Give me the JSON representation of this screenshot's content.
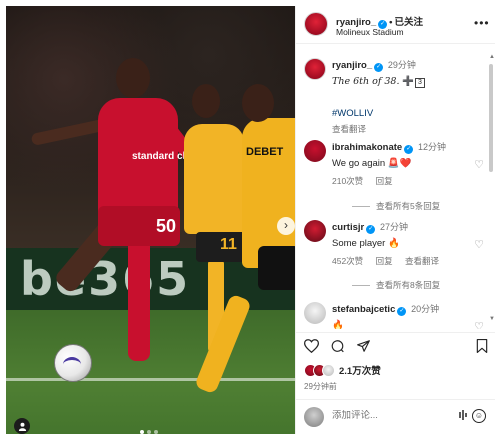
{
  "post": {
    "author": "ryanjiro_",
    "follow_label": "已关注",
    "location": "Molineux Stadium",
    "more_label": "•••"
  },
  "media": {
    "board_text": "be365",
    "shirt_number": "50",
    "sponsor": "standard chartered",
    "opponent_number": "11",
    "opponent_sponsor": "DEBET",
    "next_label": "›",
    "slide_count": 3,
    "active_slide": 1,
    "user_tag_icon": "person-icon"
  },
  "caption": {
    "user": "ryanjiro_",
    "time": "29分钟",
    "text": "The 6th of 38.",
    "emoji": "➕",
    "boxed": "3",
    "hashtag": "#WOLLIV",
    "translate": "查看翻译"
  },
  "comments": [
    {
      "user": "ibrahimakonate",
      "verified": true,
      "time": "12分钟",
      "text": "We go again 🚨❤️",
      "likes": "210次赞",
      "reply": "回复",
      "view_replies": "查看所有5条回复"
    },
    {
      "user": "curtisjr",
      "verified": true,
      "time": "27分钟",
      "text": "Some player 🔥",
      "likes": "452次赞",
      "reply": "回复",
      "translate": "查看翻译",
      "view_replies": "查看所有8条回复"
    },
    {
      "user": "stefanbajcetic",
      "verified": true,
      "time": "20分钟",
      "text": "🔥"
    }
  ],
  "actions": {
    "like_icon": "heart-icon",
    "comment_icon": "comment-icon",
    "share_icon": "send-icon",
    "save_icon": "bookmark-icon",
    "likes_count": "2.1万次赞",
    "posted_ago": "29分钟前"
  },
  "add_comment": {
    "placeholder": "添加评论..."
  },
  "colors": {
    "verified": "#0095f6",
    "liverpool_red": "#c8102e",
    "wolves_gold": "#f2b426",
    "muted_text": "#737373"
  }
}
